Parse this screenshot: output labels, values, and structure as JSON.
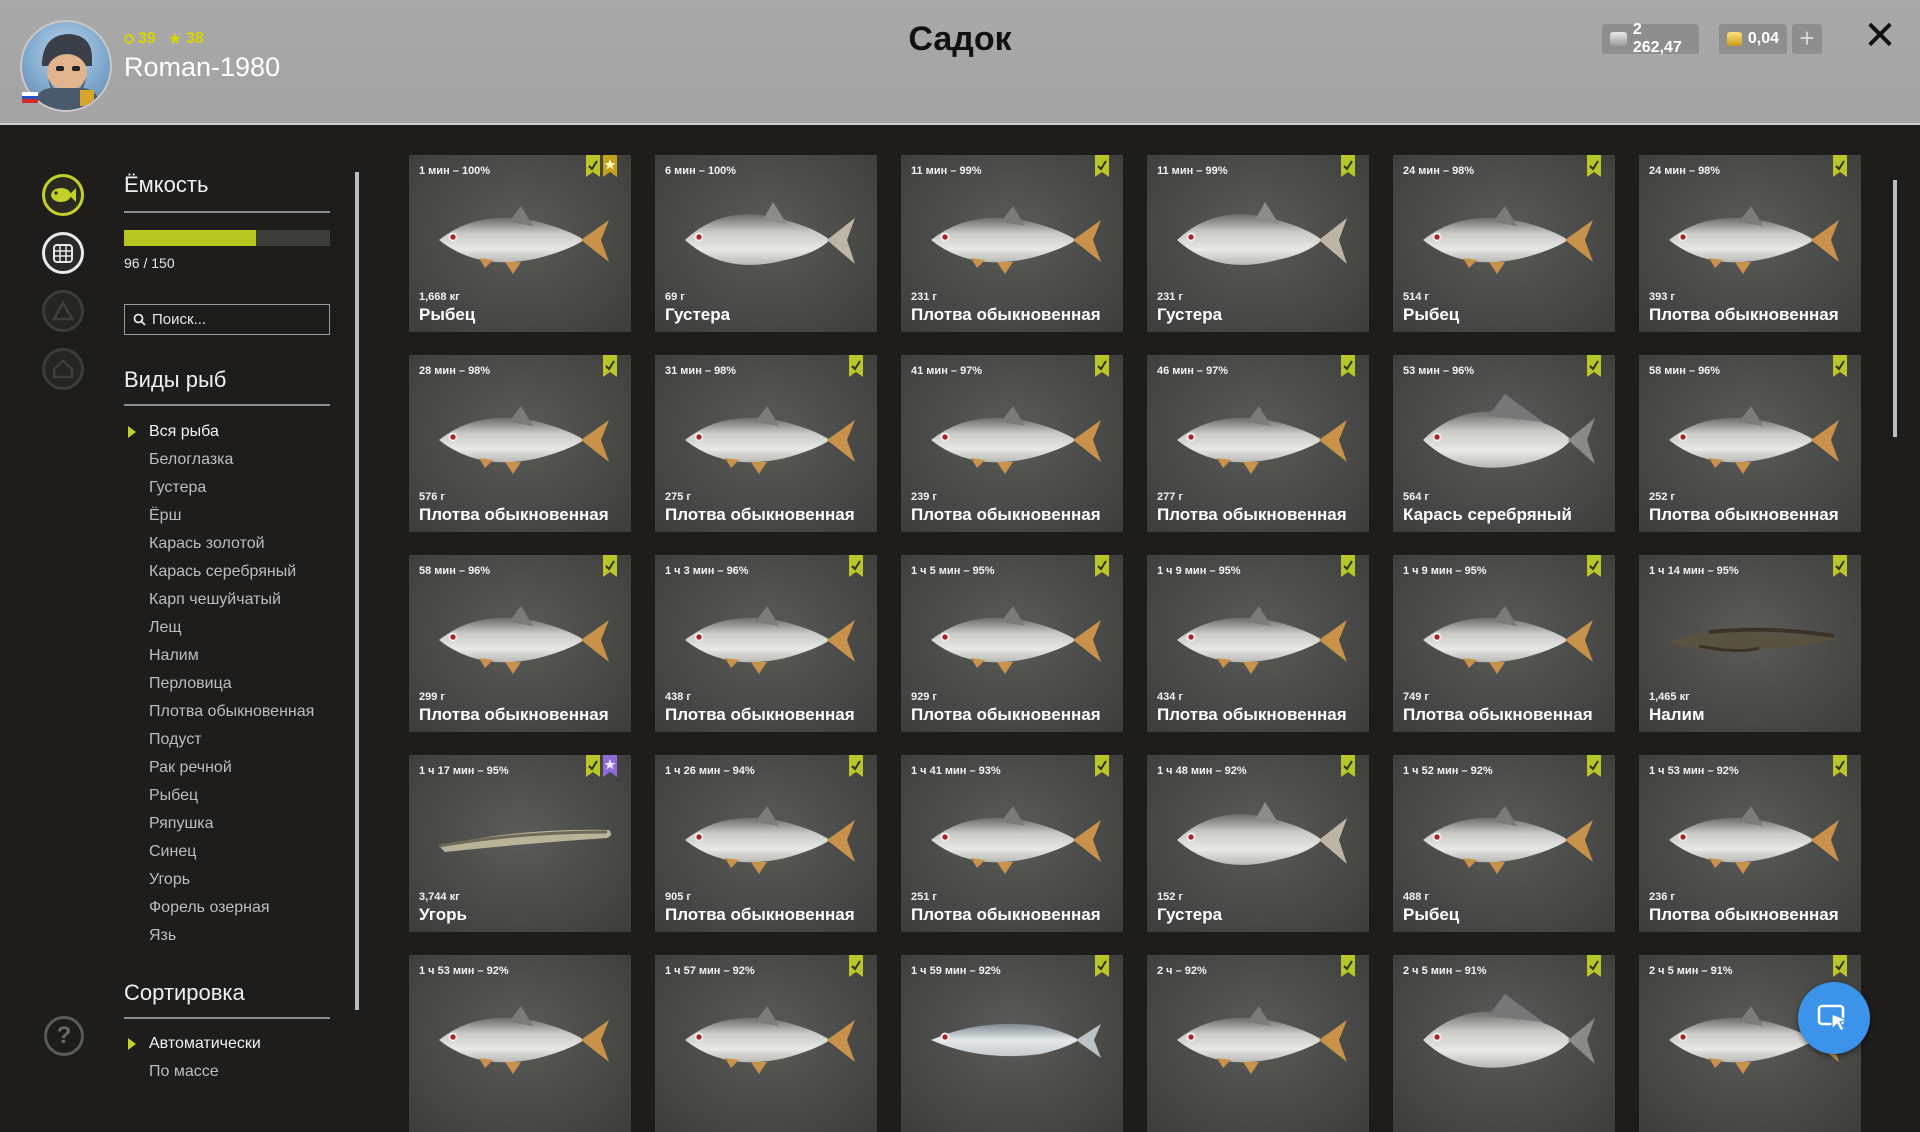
{
  "header": {
    "title": "Садок",
    "username": "Roman-1980",
    "level": "39",
    "stars": "38",
    "silver": "2 262,47",
    "gold": "0,04",
    "plus_icon": "plus-icon",
    "close_icon": "close-icon"
  },
  "sidebar": {
    "capacity_title": "Ёмкость",
    "capacity_fraction": 0.64,
    "capacity_text": "96 / 150",
    "search_placeholder": "Поиск...",
    "species_title": "Виды рыб",
    "species": [
      "Вся рыба",
      "Белоглазка",
      "Густера",
      "Ёрш",
      "Карась золотой",
      "Карась серебряный",
      "Карп чешуйчатый",
      "Лещ",
      "Налим",
      "Перловица",
      "Плотва обыкновенная",
      "Подуст",
      "Рак речной",
      "Рыбец",
      "Ряпушка",
      "Синец",
      "Угорь",
      "Форель озерная",
      "Язь"
    ],
    "sort_title": "Сортировка",
    "sort_options": [
      "Автоматически",
      "По массе"
    ]
  },
  "colors": {
    "accent": "#c3d02a",
    "header_bg": "#a6a6a6",
    "card_bg": "#4a4a48",
    "fab": "#3b93ea"
  },
  "cards": [
    {
      "time": "1 мин – 100%",
      "weight": "1,668 кг",
      "name": "Рыбец",
      "kind": "roach",
      "marks": [
        "green",
        "gold"
      ]
    },
    {
      "time": "6 мин – 100%",
      "weight": "69 г",
      "name": "Густера",
      "kind": "bream",
      "marks": []
    },
    {
      "time": "11 мин – 99%",
      "weight": "231 г",
      "name": "Плотва обыкновенная",
      "kind": "roach",
      "marks": [
        "green"
      ]
    },
    {
      "time": "11 мин – 99%",
      "weight": "231 г",
      "name": "Густера",
      "kind": "bream",
      "marks": [
        "green"
      ]
    },
    {
      "time": "24 мин – 98%",
      "weight": "514 г",
      "name": "Рыбец",
      "kind": "roach",
      "marks": [
        "green"
      ]
    },
    {
      "time": "24 мин – 98%",
      "weight": "393 г",
      "name": "Плотва обыкновенная",
      "kind": "roach",
      "marks": [
        "green"
      ]
    },
    {
      "time": "28 мин – 98%",
      "weight": "576 г",
      "name": "Плотва обыкновенная",
      "kind": "roach",
      "marks": [
        "green"
      ]
    },
    {
      "time": "31 мин – 98%",
      "weight": "275 г",
      "name": "Плотва обыкновенная",
      "kind": "roach",
      "marks": [
        "green"
      ]
    },
    {
      "time": "41 мин – 97%",
      "weight": "239 г",
      "name": "Плотва обыкновенная",
      "kind": "roach",
      "marks": [
        "green"
      ]
    },
    {
      "time": "46 мин – 97%",
      "weight": "277 г",
      "name": "Плотва обыкновенная",
      "kind": "roach",
      "marks": [
        "green"
      ]
    },
    {
      "time": "53 мин – 96%",
      "weight": "564 г",
      "name": "Карась серебряный",
      "kind": "carp",
      "marks": [
        "green"
      ]
    },
    {
      "time": "58 мин – 96%",
      "weight": "252 г",
      "name": "Плотва обыкновенная",
      "kind": "roach",
      "marks": [
        "green"
      ]
    },
    {
      "time": "58 мин – 96%",
      "weight": "299 г",
      "name": "Плотва обыкновенная",
      "kind": "roach",
      "marks": [
        "green"
      ]
    },
    {
      "time": "1 ч 3 мин – 96%",
      "weight": "438 г",
      "name": "Плотва обыкновенная",
      "kind": "roach",
      "marks": [
        "green"
      ]
    },
    {
      "time": "1 ч 5 мин – 95%",
      "weight": "929 г",
      "name": "Плотва обыкновенная",
      "kind": "roach",
      "marks": [
        "green"
      ]
    },
    {
      "time": "1 ч 9 мин – 95%",
      "weight": "434 г",
      "name": "Плотва обыкновенная",
      "kind": "roach",
      "marks": [
        "green"
      ]
    },
    {
      "time": "1 ч 9 мин – 95%",
      "weight": "749 г",
      "name": "Плотва обыкновенная",
      "kind": "roach",
      "marks": [
        "green"
      ]
    },
    {
      "time": "1 ч 14 мин – 95%",
      "weight": "1,465 кг",
      "name": "Налим",
      "kind": "burbot",
      "marks": [
        "green"
      ]
    },
    {
      "time": "1 ч 17 мин – 95%",
      "weight": "3,744 кг",
      "name": "Угорь",
      "kind": "eel",
      "marks": [
        "green",
        "purple"
      ]
    },
    {
      "time": "1 ч 26 мин – 94%",
      "weight": "905 г",
      "name": "Плотва обыкновенная",
      "kind": "roach",
      "marks": [
        "green"
      ]
    },
    {
      "time": "1 ч 41 мин – 93%",
      "weight": "251 г",
      "name": "Плотва обыкновенная",
      "kind": "roach",
      "marks": [
        "green"
      ]
    },
    {
      "time": "1 ч 48 мин – 92%",
      "weight": "152 г",
      "name": "Густера",
      "kind": "bream",
      "marks": [
        "green"
      ]
    },
    {
      "time": "1 ч 52 мин – 92%",
      "weight": "488 г",
      "name": "Рыбец",
      "kind": "roach",
      "marks": [
        "green"
      ]
    },
    {
      "time": "1 ч 53 мин – 92%",
      "weight": "236 г",
      "name": "Плотва обыкновенная",
      "kind": "roach",
      "marks": [
        "green"
      ]
    },
    {
      "time": "1 ч 53 мин – 92%",
      "weight": "",
      "name": "",
      "kind": "roach",
      "marks": []
    },
    {
      "time": "1 ч 57 мин – 92%",
      "weight": "",
      "name": "",
      "kind": "roach",
      "marks": [
        "green"
      ]
    },
    {
      "time": "1 ч 59 мин – 92%",
      "weight": "",
      "name": "",
      "kind": "whitefish",
      "marks": [
        "green"
      ]
    },
    {
      "time": "2 ч – 92%",
      "weight": "",
      "name": "",
      "kind": "roach",
      "marks": [
        "green"
      ]
    },
    {
      "time": "2 ч 5 мин – 91%",
      "weight": "",
      "name": "",
      "kind": "carp",
      "marks": [
        "green"
      ]
    },
    {
      "time": "2 ч 5 мин – 91%",
      "weight": "",
      "name": "",
      "kind": "roach",
      "marks": [
        "green"
      ]
    }
  ]
}
